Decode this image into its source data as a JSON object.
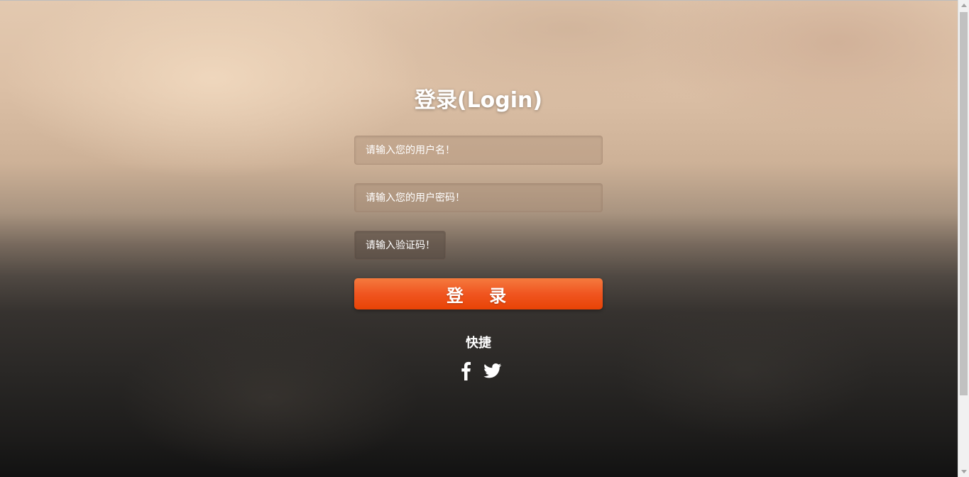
{
  "login": {
    "title": "登录(Login)",
    "username_placeholder": "请输入您的用户名！",
    "password_placeholder": "请输入您的用户密码！",
    "captcha_placeholder": "请输入验证码！",
    "submit_label": "登 录"
  },
  "shortcuts": {
    "label": "快捷",
    "links": [
      {
        "icon": "facebook-icon"
      },
      {
        "icon": "twitter-icon"
      }
    ]
  },
  "colors": {
    "button_orange": "#f05520",
    "text": "#ffffff"
  }
}
